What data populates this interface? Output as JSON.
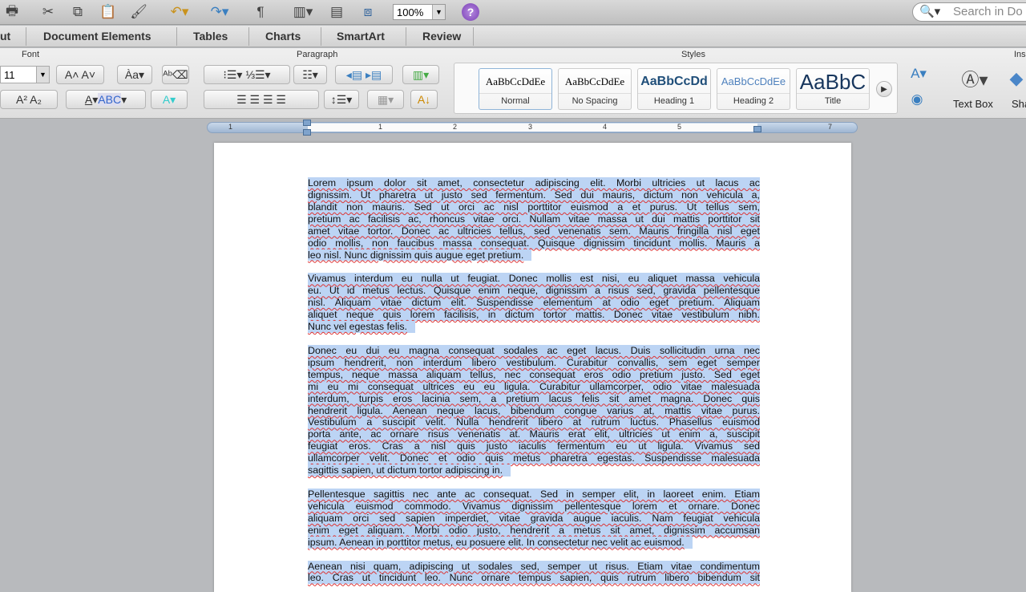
{
  "toolbar": {
    "zoom": "100%",
    "search_placeholder": "Search in Do",
    "help": "?",
    "pilcrow": "¶"
  },
  "tabs": [
    "ut",
    "Document Elements",
    "Tables",
    "Charts",
    "SmartArt",
    "Review"
  ],
  "ribbon": {
    "font_group": "Font",
    "paragraph_group": "Paragraph",
    "styles_group": "Styles",
    "insert_group": "Ins",
    "font_size": "11",
    "styles": [
      {
        "preview": "AaBbCcDdEe",
        "label": "Normal",
        "selected": true
      },
      {
        "preview": "AaBbCcDdEe",
        "label": "No Spacing"
      },
      {
        "preview": "AaBbCcDd",
        "label": "Heading 1"
      },
      {
        "preview": "AaBbCcDdEe",
        "label": "Heading 2"
      },
      {
        "preview": "AaBbC",
        "label": "Title"
      }
    ],
    "text_box": "Text Box",
    "shape": "Sha"
  },
  "ruler": {
    "numbers": [
      "1",
      "1",
      "2",
      "3",
      "4",
      "5",
      "7"
    ]
  },
  "colors": {
    "selection": "#bcd4f4",
    "accent": "#8fb4d8"
  },
  "document": {
    "paragraphs": [
      [
        "Lorem ipsum dolor sit amet, consectetur adipiscing elit. Morbi ultricies ut lacus ac",
        "dignissim. Ut pharetra ut justo sed fermentum. Sed dui mauris, dictum non vehicula a,",
        "blandit non mauris. Sed ut orci ac nisl porttitor euismod a et purus. Ut tellus sem,",
        "pretium ac facilisis ac, rhoncus vitae orci. Nullam vitae massa ut dui mattis porttitor sit",
        "amet vitae tortor. Donec ac ultricies tellus, sed venenatis sem. Mauris fringilla nisl eget",
        "odio mollis, non faucibus massa consequat. Quisque dignissim tincidunt mollis. Mauris a",
        "leo nisl. Nunc dignissim quis augue eget pretium."
      ],
      [
        "Vivamus interdum eu nulla ut feugiat. Donec mollis est nisi, eu aliquet massa vehicula",
        "eu. Ut id metus lectus. Quisque enim neque, dignissim a risus sed, gravida pellentesque",
        "nisl. Aliquam vitae dictum elit. Suspendisse elementum at odio eget pretium. Aliquam",
        "aliquet neque quis lorem facilisis, in dictum tortor mattis. Donec vitae vestibulum nibh.",
        "Nunc vel egestas felis."
      ],
      [
        "Donec eu dui eu magna consequat sodales ac eget lacus. Duis sollicitudin urna nec",
        "ipsum hendrerit, non interdum libero vestibulum. Curabitur convallis, sem eget semper",
        "tempus, neque massa aliquam tellus, nec consequat eros odio pretium justo. Sed eget",
        "mi eu mi consequat ultrices eu eu ligula. Curabitur ullamcorper, odio vitae malesuada",
        "interdum, turpis eros lacinia sem, a pretium lacus felis sit amet magna. Donec quis",
        "hendrerit ligula. Aenean neque lacus, bibendum congue varius at, mattis vitae purus.",
        "Vestibulum a suscipit velit. Nulla hendrerit libero at rutrum luctus. Phasellus euismod",
        "porta ante, ac ornare risus venenatis at. Mauris erat elit, ultricies ut enim a, suscipit",
        "feugiat eros. Cras a nisl quis justo iaculis fermentum eu ut ligula. Vivamus sed",
        "ullamcorper velit. Donec et odio quis metus pharetra egestas. Suspendisse malesuada",
        "sagittis sapien, ut dictum tortor adipiscing in."
      ],
      [
        "Pellentesque sagittis nec ante ac consequat. Sed in semper elit, in laoreet enim. Etiam",
        "vehicula euismod commodo. Vivamus dignissim pellentesque lorem et ornare. Donec",
        "aliquam orci sed sapien imperdiet, vitae gravida augue iaculis. Nam feugiat vehicula",
        "enim eget aliquam. Morbi odio justo, hendrerit a metus sit amet, dignissim accumsan",
        "ipsum. Aenean in porttitor metus, eu posuere elit. In consectetur nec velit ac euismod."
      ],
      [
        "Aenean nisi quam, adipiscing ut sodales sed, semper ut risus. Etiam vitae condimentum",
        "leo. Cras ut tincidunt leo. Nunc ornare tempus sapien, quis rutrum libero bibendum sit"
      ]
    ]
  }
}
